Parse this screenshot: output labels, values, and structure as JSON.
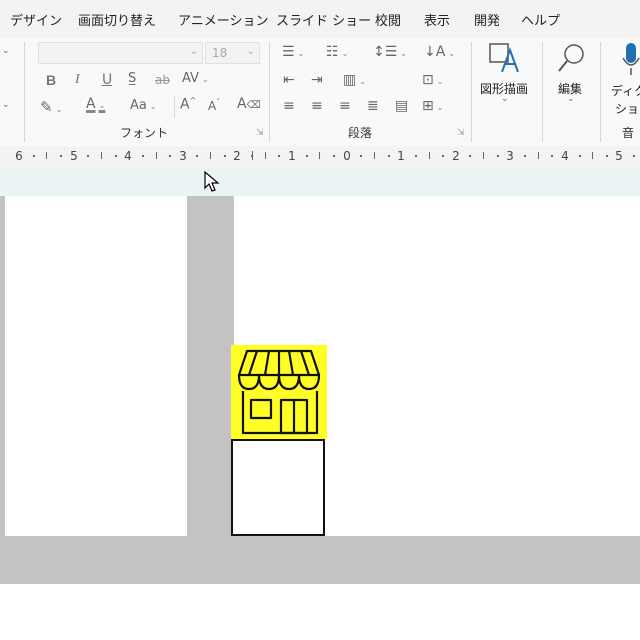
{
  "tabs": [
    "デザイン",
    "画面切り替え",
    "アニメーション",
    "スライド ショー",
    "校閲",
    "表示",
    "開発",
    "ヘルプ"
  ],
  "font_group": {
    "label": "フォント",
    "font_name_value": "",
    "font_size_value": "18",
    "bold": "B",
    "italic": "I",
    "underline": "U",
    "strikethrough": "ab",
    "char_spacing": "AV",
    "font_color_glyph": "A",
    "change_case": "Aa",
    "grow_font": "A",
    "shrink_font": "A"
  },
  "paragraph_group": {
    "label": "段落"
  },
  "drawing_button": {
    "label": "図形描画"
  },
  "editing_button": {
    "label": "編集"
  },
  "dictate_button": {
    "label_line1": "ディク",
    "label_line2": "ション"
  },
  "voice_group": {
    "label": "音"
  },
  "ruler": {
    "numbers": [
      "6",
      "5",
      "4",
      "3",
      "2",
      "1",
      "0",
      "1",
      "2",
      "3",
      "4",
      "5"
    ]
  },
  "colors": {
    "highlight_yellow": "#ffff26",
    "gray_border": "#c3c3c3",
    "tab_bar": "#f3f3f3",
    "band": "#eaf4f5"
  },
  "icons": [
    "shop-icon",
    "mouse-pointer-icon",
    "draw-shapes-icon",
    "search-icon",
    "microphone-icon"
  ]
}
